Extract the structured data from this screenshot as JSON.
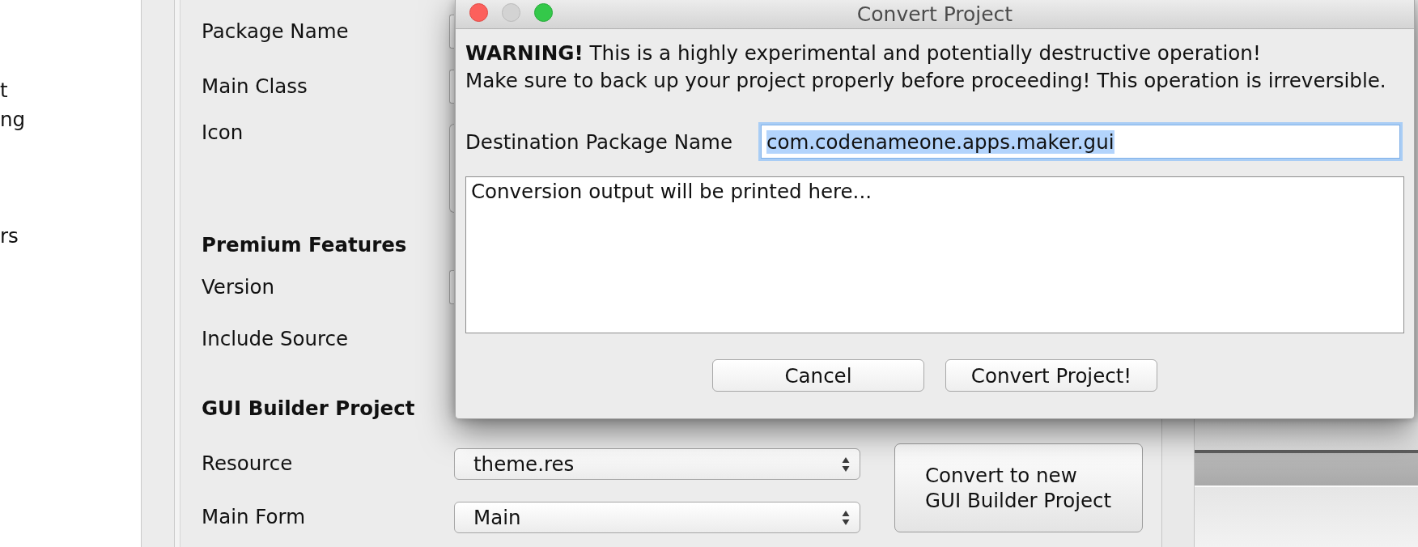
{
  "sidebar": {
    "items": [
      {
        "label": "t"
      },
      {
        "label": "ng"
      },
      {
        "label": "rs"
      }
    ]
  },
  "form": {
    "rows": [
      {
        "kind": "field",
        "label": "Package Name"
      },
      {
        "kind": "field",
        "label": "Main Class"
      },
      {
        "kind": "image_button",
        "label": "Icon"
      },
      {
        "kind": "heading",
        "label": "Premium Features"
      },
      {
        "kind": "field",
        "label": "Version"
      },
      {
        "kind": "plain",
        "label": "Include Source"
      },
      {
        "kind": "heading",
        "label": "GUI Builder Project"
      },
      {
        "kind": "select",
        "label": "Resource",
        "value": "theme.res"
      },
      {
        "kind": "select",
        "label": "Main Form",
        "value": "Main"
      }
    ],
    "convert_button": {
      "label": "Convert to new\nGUI Builder Project"
    }
  },
  "dialog": {
    "title": "Convert Project",
    "window_buttons": [
      {
        "kind": "close",
        "disabled": false
      },
      {
        "kind": "minimize",
        "disabled": true
      },
      {
        "kind": "zoom",
        "disabled": false
      }
    ],
    "warning_lines": [
      "**WARNING!** This is a highly experimental and potentially destructive operation!",
      "Make sure to back up your project properly before proceeding! This operation is irreversible."
    ],
    "destination": {
      "label": "Destination Package Name",
      "value": "com.codenameone.apps.maker.gui",
      "focused": true,
      "text_selected": true
    },
    "output": {
      "value": "Conversion output will be printed here..."
    },
    "buttons": [
      {
        "label": "Cancel"
      },
      {
        "label": "Convert Project!"
      }
    ]
  }
}
